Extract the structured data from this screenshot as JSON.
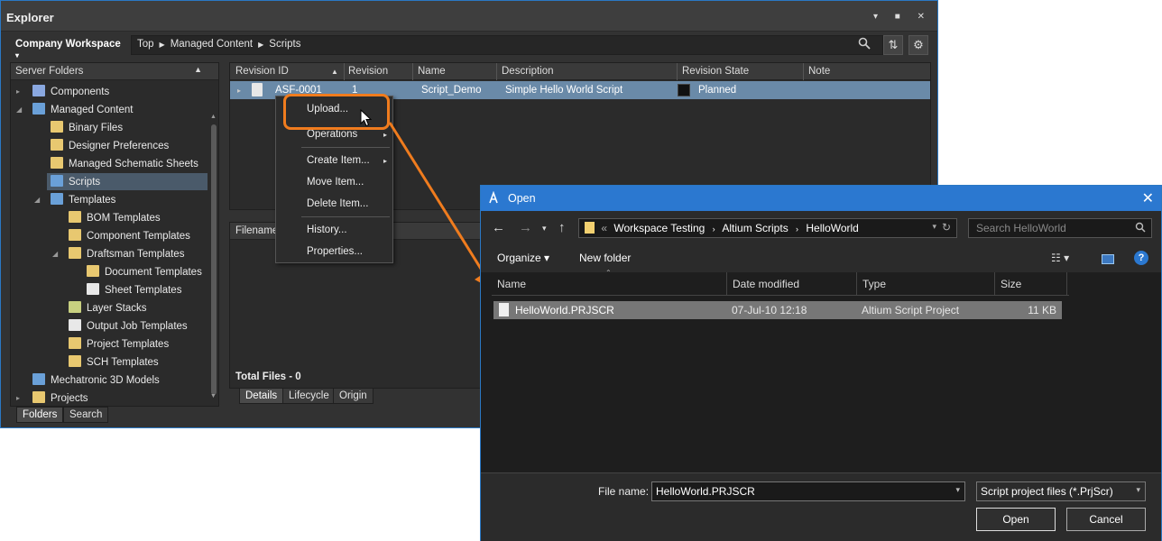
{
  "explorer": {
    "title": "Explorer",
    "title_buttons": "▾ ■ ✕",
    "workspace_label": "Company Workspace",
    "breadcrumb": [
      "Top",
      "Managed Content",
      "Scripts"
    ],
    "left_header": "Server Folders",
    "tree": [
      {
        "label": "Components",
        "level": 1,
        "expander": "▸",
        "icon_color": "#8aa8e0"
      },
      {
        "label": "Managed Content",
        "level": 1,
        "expander": "◢",
        "icon_color": "#6aa0d8"
      },
      {
        "label": "Binary Files",
        "level": 2,
        "expander": "",
        "icon_color": "#e8c870"
      },
      {
        "label": "Designer Preferences",
        "level": 2,
        "expander": "",
        "icon_color": "#e8c870"
      },
      {
        "label": "Managed Schematic Sheets",
        "level": 2,
        "expander": "",
        "icon_color": "#e8c870"
      },
      {
        "label": "Scripts",
        "level": 2,
        "expander": "",
        "icon_color": "#6aa0d8",
        "selected": true
      },
      {
        "label": "Templates",
        "level": 2,
        "expander": "◢",
        "icon_color": "#6aa0d8"
      },
      {
        "label": "BOM Templates",
        "level": 3,
        "expander": "",
        "icon_color": "#e8c870"
      },
      {
        "label": "Component Templates",
        "level": 3,
        "expander": "",
        "icon_color": "#e8c870"
      },
      {
        "label": "Draftsman Templates",
        "level": 3,
        "expander": "◢",
        "icon_color": "#e8c870"
      },
      {
        "label": "Document Templates",
        "level": 4,
        "expander": "",
        "icon_color": "#e8c870"
      },
      {
        "label": "Sheet Templates",
        "level": 4,
        "expander": "",
        "icon_color": "#e8e8e8"
      },
      {
        "label": "Layer Stacks",
        "level": 3,
        "expander": "",
        "icon_color": "#c8d080"
      },
      {
        "label": "Output Job Templates",
        "level": 3,
        "expander": "",
        "icon_color": "#e8e8e8"
      },
      {
        "label": "Project Templates",
        "level": 3,
        "expander": "",
        "icon_color": "#e8c870"
      },
      {
        "label": "SCH Templates",
        "level": 3,
        "expander": "",
        "icon_color": "#e8c870"
      },
      {
        "label": "Mechatronic 3D Models",
        "level": 1,
        "expander": "",
        "icon_color": "#6aa0d8"
      },
      {
        "label": "Projects",
        "level": 1,
        "expander": "▸",
        "icon_color": "#e8c870"
      }
    ],
    "bottom_tabs": [
      "Folders",
      "Search"
    ],
    "grid_columns": [
      "Revision ID",
      "Revision",
      "Name",
      "Description",
      "Revision State",
      "Note"
    ],
    "grid_row": {
      "revision_id": "ASF-0001",
      "revision": "1",
      "name": "Script_Demo",
      "description": "Simple Hello World Script",
      "state": "Planned"
    },
    "files_header": "Filename",
    "total_files": "Total Files - 0",
    "detail_tabs": [
      "Details",
      "Lifecycle",
      "Origin"
    ]
  },
  "context_menu": {
    "items": [
      {
        "label": "Upload...",
        "arrow": ""
      },
      {
        "label": "Operations",
        "arrow": "▸"
      },
      {
        "label": "Create Item...",
        "arrow": "▸"
      },
      {
        "label": "Move Item...",
        "arrow": ""
      },
      {
        "label": "Delete Item...",
        "arrow": ""
      },
      {
        "label": "History...",
        "arrow": ""
      },
      {
        "label": "Properties...",
        "arrow": ""
      }
    ]
  },
  "open_dialog": {
    "title": "Open",
    "path": [
      "«",
      "Workspace Testing",
      "Altium Scripts",
      "HelloWorld"
    ],
    "search_placeholder": "Search HelloWorld",
    "organize_label": "Organize ▾",
    "new_folder_label": "New folder",
    "columns": [
      "Name",
      "Date modified",
      "Type",
      "Size"
    ],
    "file": {
      "name": "HelloWorld.PRJSCR",
      "date": "07-Jul-10 12:18",
      "type": "Altium Script Project",
      "size": "11 KB"
    },
    "file_name_label": "File name:",
    "file_name_value": "HelloWorld.PRJSCR",
    "filter_value": "Script project files (*.PrjScr)",
    "open_label": "Open",
    "cancel_label": "Cancel"
  },
  "colors": {
    "accent": "#2b78d0",
    "highlight": "#f07c1e",
    "selection": "#6a8aa8"
  }
}
